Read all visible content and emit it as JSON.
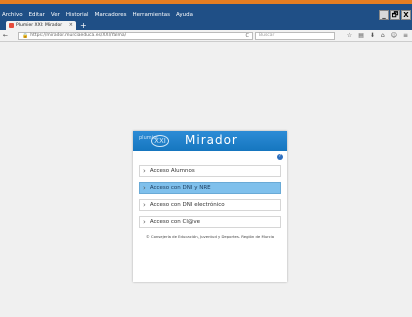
{
  "menubar": {
    "items": [
      "Archivo",
      "Editar",
      "Ver",
      "Historial",
      "Marcadores",
      "Herramientas",
      "Ayuda"
    ]
  },
  "window_controls": [
    "_",
    "🗗",
    "X"
  ],
  "tab": {
    "title": "Plumier XXI: Mirador",
    "close": "×",
    "new_tab": "+"
  },
  "navbar": {
    "back": "←",
    "url": "https://mirador.murciaeduca.es/XXI/Yalma/",
    "reload": "C",
    "search_placeholder": "Buscar"
  },
  "toolbar_icons": [
    "☆",
    "▤",
    "⬇",
    "⌂",
    "☺",
    "≡"
  ],
  "login": {
    "logo_text": "plumier",
    "logo_mark": "XXI",
    "title": "Mirador",
    "help": "?",
    "options": [
      "Acceso Alumnos",
      "Acceso con DNI y NRE",
      "Acceso con DNI electrónico",
      "Acceso con Cl@ve"
    ],
    "active_index": 1,
    "footer": "© Consejería de Educación, Juventud y Deportes. Región de Murcia"
  },
  "colors": {
    "titlebar": "#1f4f86",
    "accent_strip": "#e67e22",
    "header_blue": "#1576bf",
    "active_item": "#7fc0ec"
  }
}
